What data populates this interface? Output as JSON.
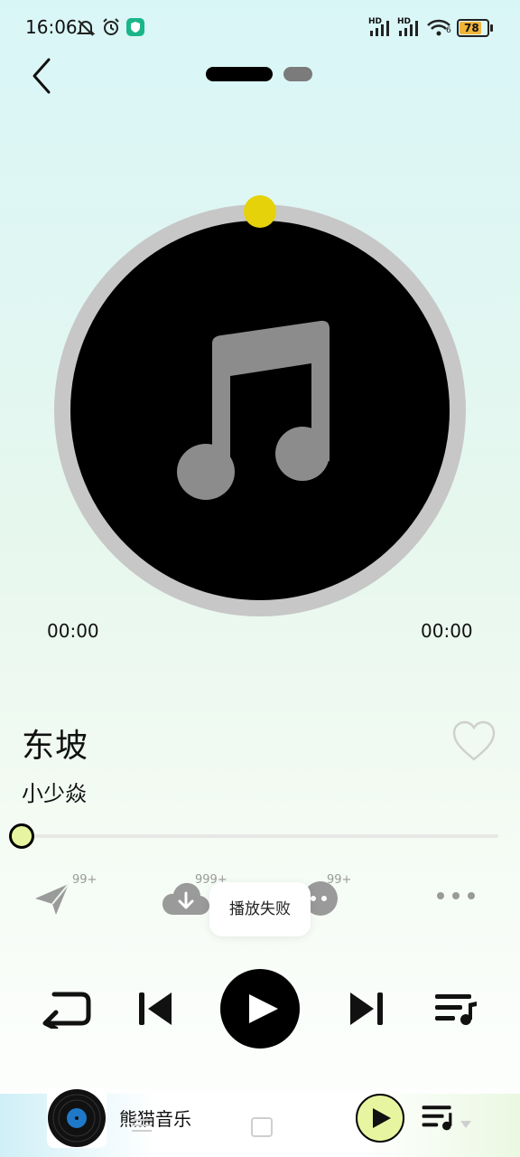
{
  "status_bar": {
    "time": "16:06",
    "battery": "78",
    "signal_labels": [
      "HD",
      "HD"
    ],
    "wifi_label": "6",
    "icons": [
      "mute-bell-icon",
      "alarm-icon",
      "shield-app-icon",
      "signal-icon",
      "signal-icon",
      "wifi-icon",
      "battery-icon"
    ]
  },
  "header": {
    "back_icon": "chevron-left-icon",
    "pager": [
      "page-1-active",
      "page-2"
    ]
  },
  "player": {
    "current_time": "00:00",
    "total_time": "00:00",
    "progress": 0,
    "disc_icon": "music-note-icon",
    "colors": {
      "knob": "#e6d20b",
      "thumb": "#e8f5a0",
      "disc": "#000000",
      "ring": "#c7c7c7"
    }
  },
  "song": {
    "title": "东坡",
    "artist": "小少焱"
  },
  "actions": [
    {
      "name": "share",
      "icon": "paper-plane-icon",
      "badge": "99+"
    },
    {
      "name": "download",
      "icon": "cloud-download-icon",
      "badge": "999+"
    },
    {
      "name": "comment",
      "icon": "comment-icon",
      "badge": "99+"
    },
    {
      "name": "more",
      "icon": "more-icon"
    }
  ],
  "toast": {
    "text": "播放失败"
  },
  "controls": [
    "repeat-icon",
    "previous-icon",
    "play-icon",
    "next-icon",
    "playlist-icon"
  ],
  "mini_player": {
    "title": "熊猫音乐",
    "cover_icon": "vinyl-record-icon",
    "play_icon": "play-icon",
    "list_icon": "playlist-icon"
  }
}
